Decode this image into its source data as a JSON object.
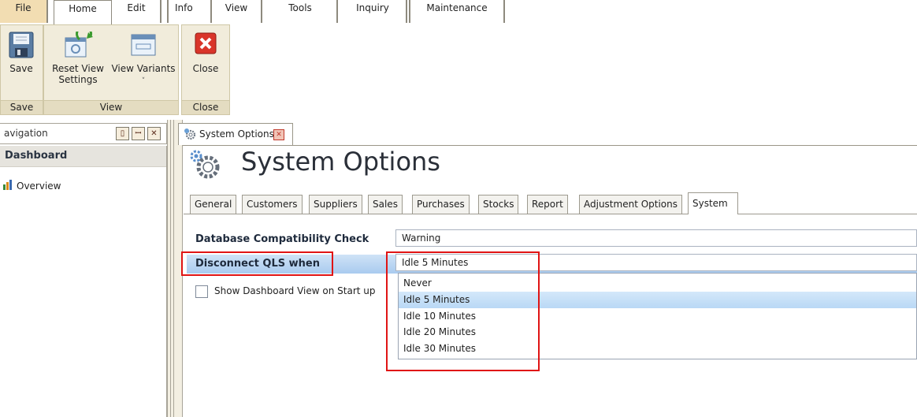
{
  "menu": {
    "tabs": [
      "File",
      "Home",
      "Edit",
      "Info",
      "View",
      "Tools",
      "Inquiry",
      "Maintenance"
    ]
  },
  "ribbon": {
    "groups": [
      {
        "label": "Save",
        "buttons": [
          {
            "label": "Save",
            "icon": "floppy-disk-icon"
          }
        ]
      },
      {
        "label": "View",
        "buttons": [
          {
            "label": "Reset View Settings",
            "icon": "reset-view-icon"
          },
          {
            "label": "View Variants",
            "icon": "window-icon",
            "dropdown": "˅"
          }
        ]
      },
      {
        "label": "Close",
        "buttons": [
          {
            "label": "Close",
            "icon": "red-close-icon"
          }
        ]
      }
    ]
  },
  "navigation": {
    "title": "avigation",
    "section": "Dashboard",
    "items": [
      {
        "label": "Overview",
        "icon": "bar-chart-icon"
      }
    ]
  },
  "document": {
    "tab_label": "System Options",
    "title": "System Options"
  },
  "option_tabs": [
    "General",
    "Customers",
    "Suppliers",
    "Sales",
    "Purchases",
    "Stocks",
    "Report",
    "Adjustment Options",
    "System"
  ],
  "active_option_tab": "System",
  "form": {
    "db_check": {
      "label": "Database Compatibility Check",
      "value": "Warning"
    },
    "disconnect": {
      "label": "Disconnect QLS when",
      "value": "Idle 5 Minutes"
    },
    "dropdown_options": [
      "Never",
      "Idle 5 Minutes",
      "Idle 10 Minutes",
      "Idle 20 Minutes",
      "Idle 30 Minutes"
    ],
    "dropdown_selected": "Idle 5 Minutes",
    "dashboard_checkbox": {
      "label": "Show Dashboard View on Start up",
      "checked": false
    }
  },
  "colors": {
    "file_tab": "#f2ddb2",
    "ribbon_group": "#f1ecdb",
    "highlight": "#b9d8f5",
    "annotation": "#e01414"
  }
}
